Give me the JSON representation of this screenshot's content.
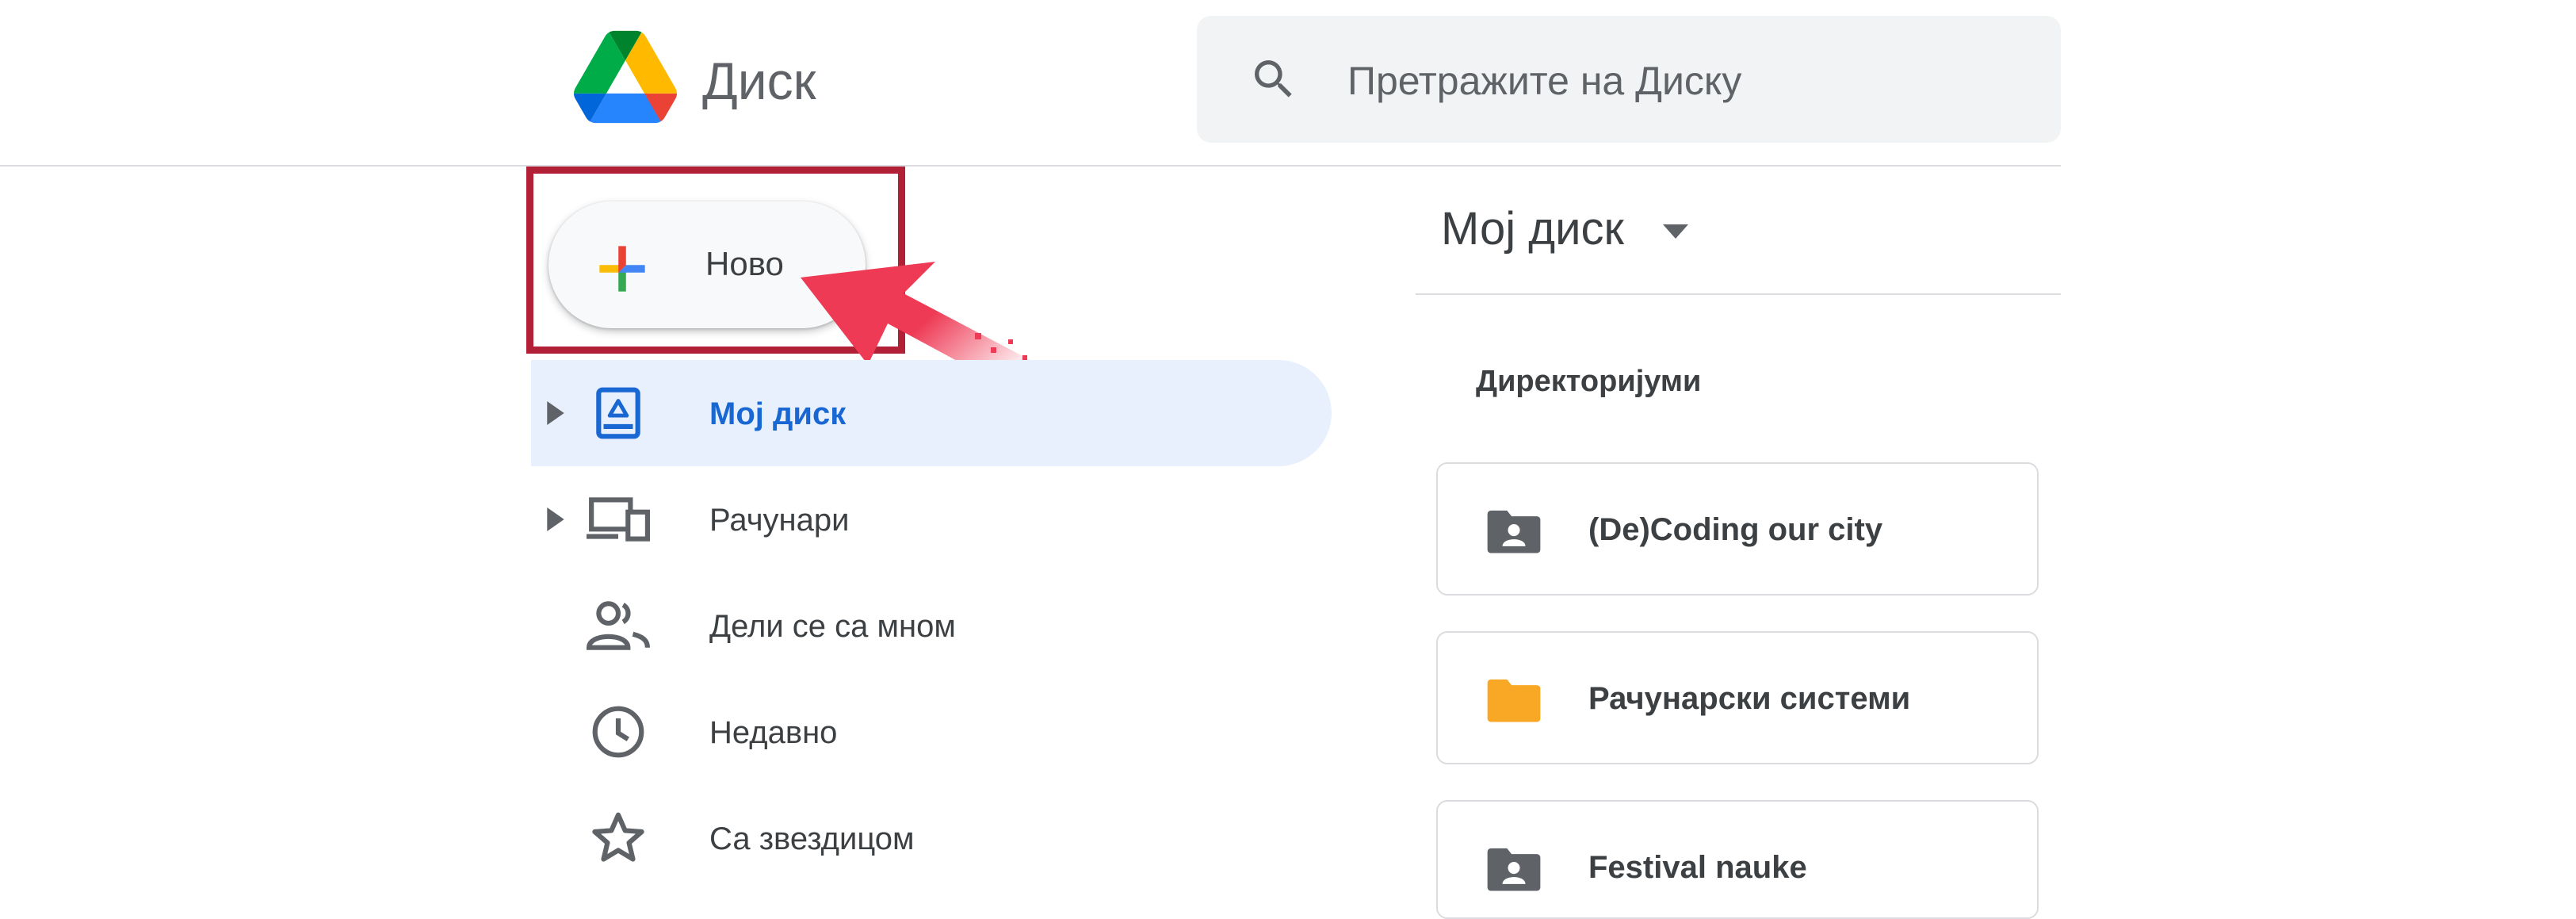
{
  "app": {
    "title": "Диск",
    "logo_icon": "google-drive-logo"
  },
  "search": {
    "placeholder": "Претражите на Диску",
    "icon": "search-icon"
  },
  "new_button": {
    "label": "Ново",
    "icon": "plus-icon",
    "highlighted": true,
    "highlight_color": "#b22037",
    "pointer_color": "#ee3a55"
  },
  "sidebar": {
    "items": [
      {
        "label": "Мој диск",
        "icon": "my-drive-icon",
        "active": true,
        "expandable": true
      },
      {
        "label": "Рачунари",
        "icon": "computers-icon",
        "active": false,
        "expandable": true
      },
      {
        "label": "Дели се са мном",
        "icon": "shared-with-me-icon",
        "active": false,
        "expandable": false
      },
      {
        "label": "Недавно",
        "icon": "recent-clock-icon",
        "active": false,
        "expandable": false
      },
      {
        "label": "Са звездицом",
        "icon": "star-icon",
        "active": false,
        "expandable": false
      }
    ]
  },
  "main": {
    "title": "Мој диск",
    "section_label": "Директоријуми",
    "folders": [
      {
        "name": "(De)Coding our city",
        "icon": "shared-folder-icon",
        "color": "#5f6368"
      },
      {
        "name": "Рачунарски системи",
        "icon": "folder-icon",
        "color": "#f9a825"
      },
      {
        "name": "Festival nauke",
        "icon": "shared-folder-icon",
        "color": "#5f6368"
      }
    ]
  },
  "colors": {
    "accent": "#1967d2",
    "active_bg": "#e8f0fe",
    "search_bg": "#f1f3f4"
  }
}
